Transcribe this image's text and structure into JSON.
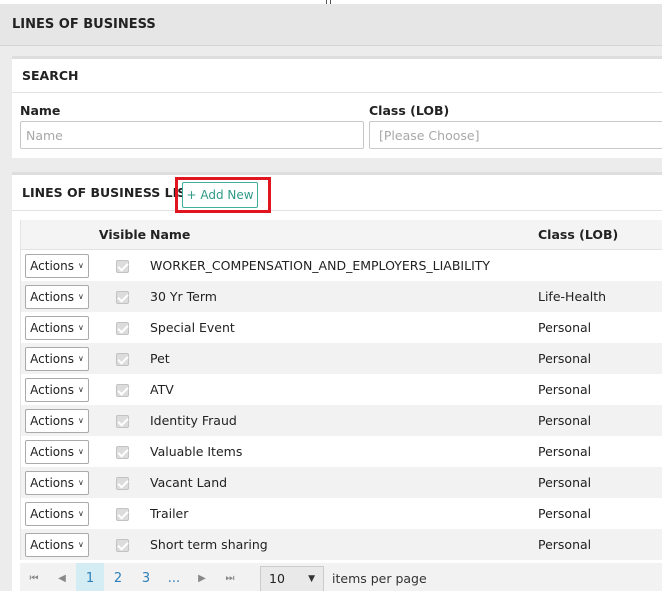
{
  "header": {
    "title": "LINES OF BUSINESS"
  },
  "search": {
    "title": "SEARCH",
    "name_label": "Name",
    "name_placeholder": "Name",
    "class_label": "Class (LOB)",
    "class_placeholder": "[Please Choose]"
  },
  "list": {
    "title": "LINES OF BUSINESS LIST",
    "add_new_label": "+ Add New",
    "columns": {
      "visible": "Visible",
      "name": "Name",
      "class": "Class (LOB)"
    },
    "action_label": "Actions",
    "rows": [
      {
        "name": "WORKER_COMPENSATION_AND_EMPLOYERS_LIABILITY",
        "class": "",
        "visible": true
      },
      {
        "name": "30 Yr Term",
        "class": "Life-Health",
        "visible": true
      },
      {
        "name": "Special Event",
        "class": "Personal",
        "visible": true
      },
      {
        "name": "Pet",
        "class": "Personal",
        "visible": true
      },
      {
        "name": "ATV",
        "class": "Personal",
        "visible": true
      },
      {
        "name": "Identity Fraud",
        "class": "Personal",
        "visible": true
      },
      {
        "name": "Valuable Items",
        "class": "Personal",
        "visible": true
      },
      {
        "name": "Vacant Land",
        "class": "Personal",
        "visible": true
      },
      {
        "name": "Trailer",
        "class": "Personal",
        "visible": true
      },
      {
        "name": "Short term sharing",
        "class": "Personal",
        "visible": true
      }
    ]
  },
  "pager": {
    "first_icon": "first-page-icon",
    "prev_icon": "prev-page-icon",
    "next_icon": "next-page-icon",
    "last_icon": "last-page-icon",
    "pages": [
      "1",
      "2",
      "3",
      "..."
    ],
    "current_page": "1",
    "page_size": "10",
    "items_label": "items per page"
  },
  "colors": {
    "accent": "#3fae9a",
    "highlight_border": "#e0151f",
    "link": "#2d7fb8"
  }
}
